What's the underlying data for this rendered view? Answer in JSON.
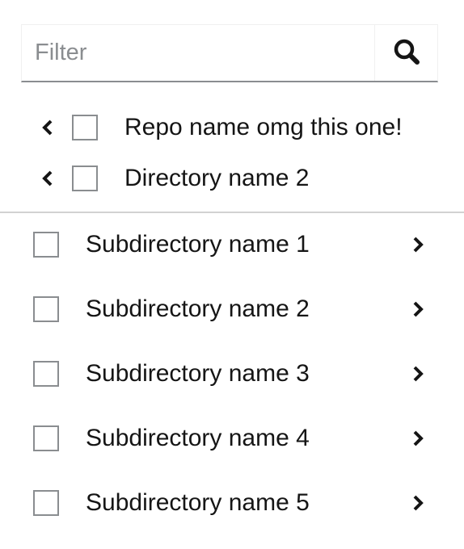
{
  "filter": {
    "placeholder": "Filter",
    "value": "",
    "search_button_icon": "search-icon"
  },
  "breadcrumb_trail": [
    {
      "label": "Repo name omg this one!",
      "checked": false,
      "back_icon": "chevron-left-icon"
    },
    {
      "label": "Directory name 2",
      "checked": false,
      "back_icon": "chevron-left-icon"
    }
  ],
  "items": [
    {
      "label": "Subdirectory name 1",
      "checked": false,
      "drill_icon": "chevron-right-icon"
    },
    {
      "label": "Subdirectory name 2",
      "checked": false,
      "drill_icon": "chevron-right-icon"
    },
    {
      "label": "Subdirectory name 3",
      "checked": false,
      "drill_icon": "chevron-right-icon"
    },
    {
      "label": "Subdirectory name 4",
      "checked": false,
      "drill_icon": "chevron-right-icon"
    },
    {
      "label": "Subdirectory name 5",
      "checked": false,
      "drill_icon": "chevron-right-icon"
    }
  ],
  "colors": {
    "text": "#151515",
    "placeholder": "#8a8d90",
    "border": "#8a8d90",
    "divider": "#d2d2d2"
  }
}
